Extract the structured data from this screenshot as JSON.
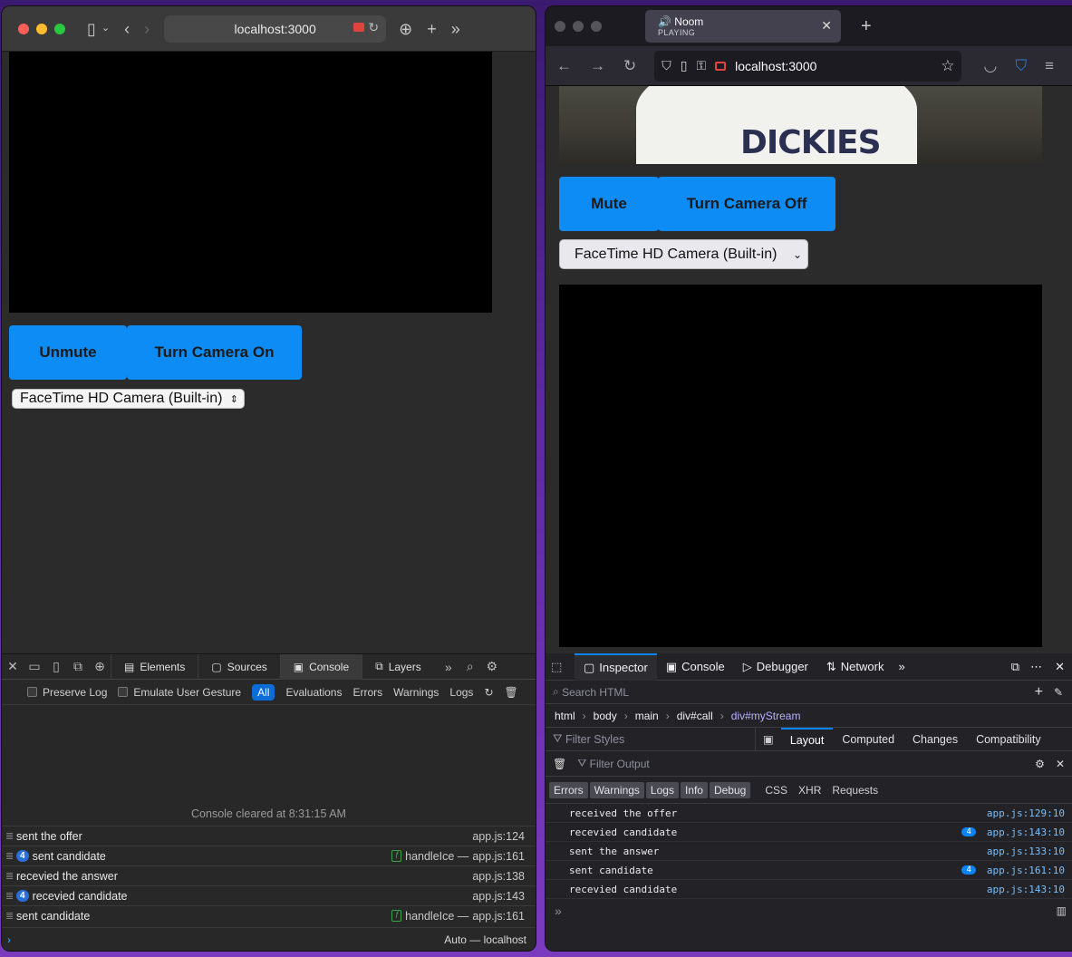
{
  "left_browser": {
    "url": "localhost:3000",
    "buttons": {
      "mute": "Unmute",
      "camera": "Turn Camera On"
    },
    "camera_select": "FaceTime HD Camera (Built-in)",
    "devtools": {
      "tabs": [
        "Elements",
        "Sources",
        "Console",
        "Layers"
      ],
      "filters": {
        "preserve_log": "Preserve Log",
        "emulate": "Emulate User Gesture",
        "all": "All",
        "evaluations": "Evaluations",
        "errors": "Errors",
        "warnings": "Warnings",
        "logs": "Logs"
      },
      "cleared": "Console cleared at 8:31:15 AM",
      "logs": [
        {
          "text": "sent the offer",
          "count": "",
          "fn": "",
          "src": "app.js:124"
        },
        {
          "text": "sent candidate",
          "count": "4",
          "fn": "handleIce —",
          "src": "app.js:161"
        },
        {
          "text": "recevied the answer",
          "count": "",
          "fn": "",
          "src": "app.js:138"
        },
        {
          "text": "recevied candidate",
          "count": "4",
          "fn": "",
          "src": "app.js:143"
        },
        {
          "text": "sent candidate",
          "count": "",
          "fn": "handleIce —",
          "src": "app.js:161"
        }
      ],
      "context": "Auto — localhost"
    }
  },
  "right_browser": {
    "tab": {
      "title": "Noom",
      "status": "PLAYING"
    },
    "url": "localhost:3000",
    "video_text": "DICKIES",
    "buttons": {
      "mute": "Mute",
      "camera": "Turn Camera Off"
    },
    "camera_select": "FaceTime HD Camera (Built-in)",
    "devtools": {
      "tabs": [
        "Inspector",
        "Console",
        "Debugger",
        "Network"
      ],
      "search_placeholder": "Search HTML",
      "breadcrumbs": [
        "html",
        "body",
        "main",
        "div#call",
        "div#myStream"
      ],
      "filter_styles": "Filter Styles",
      "rule_tabs": [
        "Layout",
        "Computed",
        "Changes",
        "Compatibility"
      ],
      "filter_output": "Filter Output",
      "levels": [
        "Errors",
        "Warnings",
        "Logs",
        "Info",
        "Debug"
      ],
      "types": [
        "CSS",
        "XHR",
        "Requests"
      ],
      "logs": [
        {
          "text": "received the offer",
          "count": "",
          "src": "app.js:129:10"
        },
        {
          "text": "recevied candidate",
          "count": "4",
          "src": "app.js:143:10"
        },
        {
          "text": "sent the answer",
          "count": "",
          "src": "app.js:133:10"
        },
        {
          "text": "sent candidate",
          "count": "4",
          "src": "app.js:161:10"
        },
        {
          "text": "recevied candidate",
          "count": "",
          "src": "app.js:143:10"
        }
      ]
    }
  }
}
